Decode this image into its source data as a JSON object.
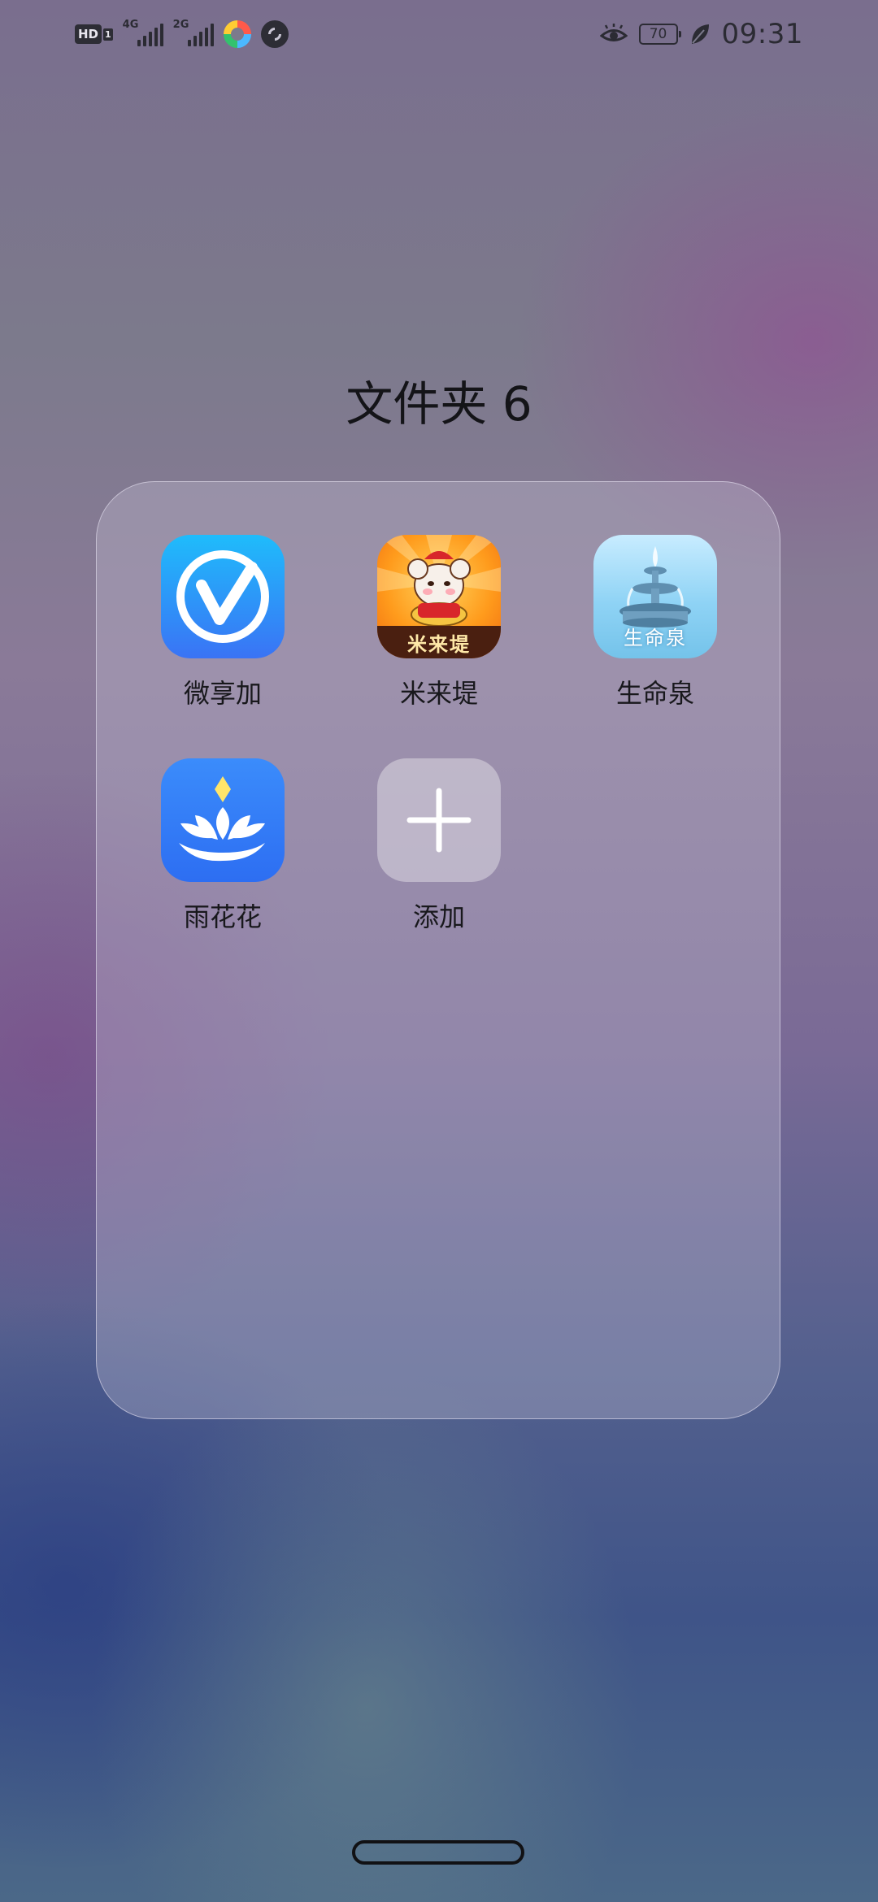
{
  "status_bar": {
    "hd_label": "HD",
    "hd_sub": "1",
    "sim1_network": "4G",
    "sim2_network": "2G",
    "battery_level": "70",
    "time": "09:31"
  },
  "folder": {
    "title": "文件夹 6",
    "apps": [
      {
        "label": "微享加",
        "icon": "wxj-app-icon"
      },
      {
        "label": "米来堤",
        "icon": "mlt-app-icon",
        "icon_text": "米来堤"
      },
      {
        "label": "生命泉",
        "icon": "smq-app-icon",
        "icon_text": "生命泉"
      },
      {
        "label": "雨花花",
        "icon": "lotus-app-icon"
      },
      {
        "label": "添加",
        "icon": "plus-icon"
      }
    ]
  },
  "colors": {
    "text_dark": "#18181c",
    "wxj_gradient_top": "#1fbcfb",
    "wxj_gradient_bottom": "#3a73f5",
    "lotus_blue": "#2d6ef2",
    "mlt_orange": "#ff9b1c"
  }
}
